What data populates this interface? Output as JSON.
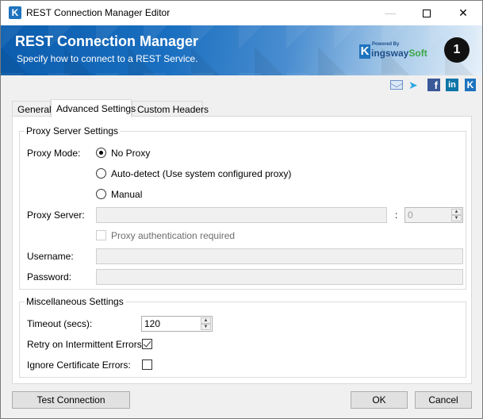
{
  "window": {
    "title": "REST Connection Manager Editor",
    "controls": {
      "minimize": "—",
      "close": "✕"
    }
  },
  "banner": {
    "title": "REST Connection Manager",
    "subtitle": "Specify how to connect to a REST Service.",
    "logo": {
      "powered_by": "Powered By",
      "k": "K",
      "name_part1": "ingsway",
      "name_part2": "Soft"
    },
    "badge": "1"
  },
  "social": {
    "icons": [
      "mail-icon",
      "twitter-icon",
      "facebook-icon",
      "linkedin-icon",
      "kingswaysoft-icon"
    ],
    "facebook_glyph": "f",
    "linkedin_glyph": "in",
    "k_glyph": "K",
    "twitter_glyph": "🐦"
  },
  "tabs": [
    {
      "label": "General",
      "active": false
    },
    {
      "label": "Advanced Settings",
      "active": true
    },
    {
      "label": "Custom Headers",
      "active": false
    }
  ],
  "proxy": {
    "legend": "Proxy Server Settings",
    "mode_label": "Proxy Mode:",
    "options": [
      {
        "label": "No Proxy",
        "checked": true
      },
      {
        "label": "Auto-detect (Use system configured proxy)",
        "checked": false
      },
      {
        "label": "Manual",
        "checked": false
      }
    ],
    "server_label": "Proxy Server:",
    "server_value": "",
    "port_separator": ":",
    "port_value": "0",
    "auth_label": "Proxy authentication required",
    "auth_checked": false,
    "username_label": "Username:",
    "username_value": "",
    "password_label": "Password:",
    "password_value": ""
  },
  "misc": {
    "legend": "Miscellaneous Settings",
    "timeout_label": "Timeout (secs):",
    "timeout_value": "120",
    "retry_label": "Retry on Intermittent Errors:",
    "retry_checked": true,
    "ignore_cert_label": "Ignore Certificate Errors:",
    "ignore_cert_checked": false
  },
  "buttons": {
    "test_connection": "Test Connection",
    "ok": "OK",
    "cancel": "Cancel"
  },
  "colors": {
    "brand_blue": "#1e73be",
    "brand_green": "#3aa845",
    "banner_start": "#0b5cad"
  }
}
